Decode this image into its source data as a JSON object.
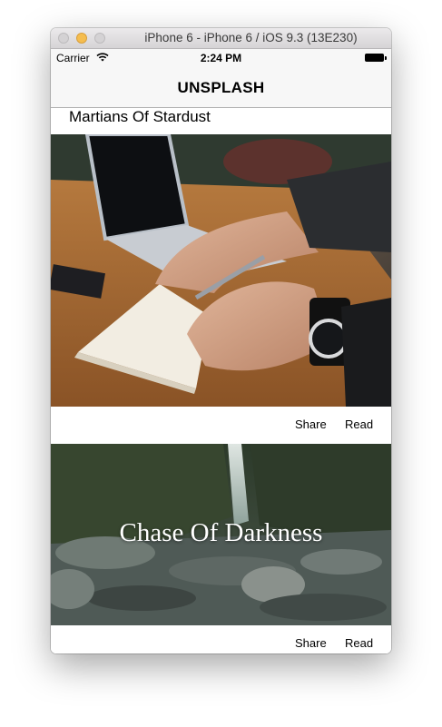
{
  "window": {
    "title": "iPhone 6 - iPhone 6 / iOS 9.3 (13E230)"
  },
  "status_bar": {
    "carrier": "Carrier",
    "time": "2:24 PM"
  },
  "nav": {
    "title": "UNSPLASH"
  },
  "cells": [
    {
      "title": "Martians Of Stardust",
      "share_label": "Share",
      "read_label": "Read"
    },
    {
      "title": "Chase Of Darkness",
      "share_label": "Share",
      "read_label": "Read"
    }
  ],
  "icons": {
    "wifi": "wifi-icon",
    "battery": "battery-icon"
  },
  "colors": {
    "traffic_min": "#f5bd4f",
    "nav_bg": "#f7f7f7"
  }
}
